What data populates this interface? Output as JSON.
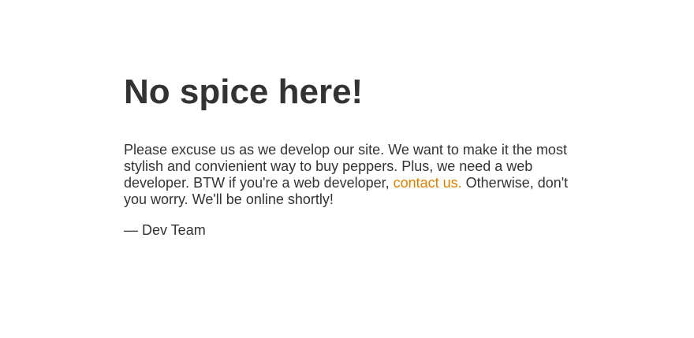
{
  "page": {
    "title": "No spice here!",
    "message_before_link": "Please excuse us as we develop our site. We want to make it the most stylish and convienient way to buy peppers. Plus, we need a web developer. BTW if you're a web developer, ",
    "link_text": "contact us.",
    "message_after_link": " Otherwise, don't you worry. We'll be online shortly!",
    "signature": "— Dev Team"
  },
  "colors": {
    "text": "#333333",
    "link": "#dc8100",
    "background": "#ffffff"
  }
}
